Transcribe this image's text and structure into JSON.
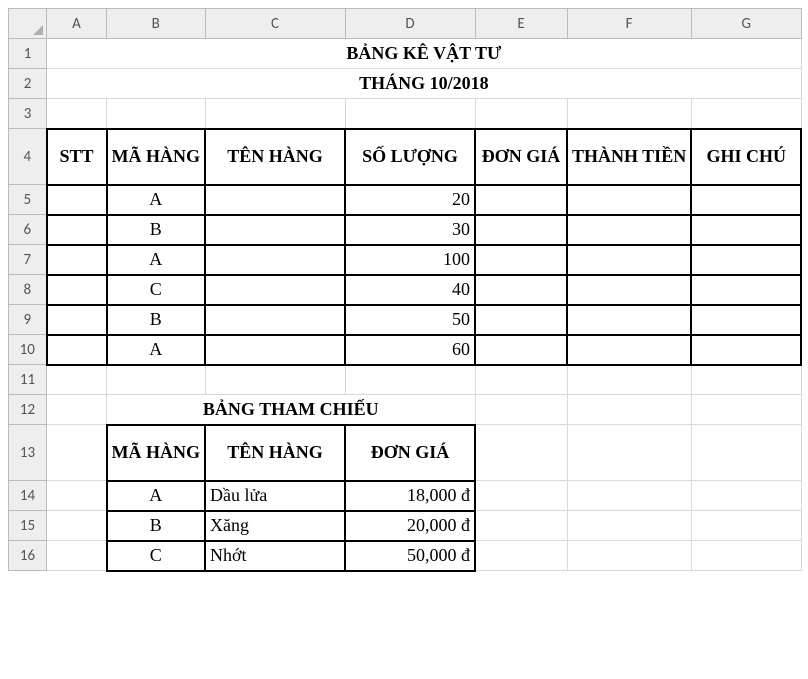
{
  "col_headers": [
    "A",
    "B",
    "C",
    "D",
    "E",
    "F",
    "G"
  ],
  "row_headers": [
    "1",
    "2",
    "3",
    "4",
    "5",
    "6",
    "7",
    "8",
    "9",
    "10",
    "11",
    "12",
    "13",
    "14",
    "15",
    "16"
  ],
  "title": "BẢNG KÊ VẬT TƯ",
  "subtitle": "THÁNG 10/2018",
  "main_headers": {
    "stt": "STT",
    "ma_hang": "MÃ HÀNG",
    "ten_hang": "TÊN HÀNG",
    "so_luong": "SỐ LƯỢNG",
    "don_gia": "ĐƠN GIÁ",
    "thanh_tien": "THÀNH TIỀN",
    "ghi_chu": "GHI CHÚ"
  },
  "main_rows": [
    {
      "ma": "A",
      "sl": "20"
    },
    {
      "ma": "B",
      "sl": "30"
    },
    {
      "ma": "A",
      "sl": "100"
    },
    {
      "ma": "C",
      "sl": "40"
    },
    {
      "ma": "B",
      "sl": "50"
    },
    {
      "ma": "A",
      "sl": "60"
    }
  ],
  "ref_title": "BẢNG THAM CHIẾU",
  "ref_headers": {
    "ma_hang": "MÃ HÀNG",
    "ten_hang": "TÊN HÀNG",
    "don_gia": "ĐƠN GIÁ"
  },
  "ref_rows": [
    {
      "ma": "A",
      "ten": "Dầu lửa",
      "gia": "18,000 đ"
    },
    {
      "ma": "B",
      "ten": "Xăng",
      "gia": "20,000 đ"
    },
    {
      "ma": "C",
      "ten": "Nhớt",
      "gia": "50,000 đ"
    }
  ]
}
